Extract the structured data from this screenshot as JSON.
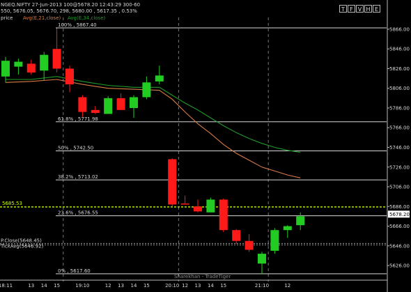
{
  "header": {
    "line1": "NGEQ.NIFTY 27-Jun-2013 100@5678.20 12:43:29 300-60",
    "line2": "550, 5676.05, 5676.70, 298, 5680.00 , 5617.35 , 0.53%",
    "line3_price": "price",
    "line3_avg21": "Avg(E,21,close)",
    "line3_avg34": "Avg(E,34,close)"
  },
  "window_buttons": [
    "T",
    "F",
    "V",
    "H",
    "E"
  ],
  "watermark": "Sharekhan - TradeTiger",
  "colors": {
    "background": "#000000",
    "up": "#22cc22",
    "down": "#ff1a1a",
    "ema21": "#d97b45",
    "ema34": "#1f9c2b",
    "fib": "#d8d8d8",
    "price_line": "#c8ff00",
    "text": "#d8d8d8"
  },
  "chart_data": {
    "type": "candlestick",
    "ylim": [
      5614,
      5878
    ],
    "y_ticks": [
      5866,
      5846,
      5826,
      5806,
      5786,
      5766,
      5746,
      5726,
      5706,
      5686,
      5666,
      5646,
      5626
    ],
    "x_ticks": [
      "18:11",
      "13",
      "14",
      "15",
      "19:10",
      "12",
      "13",
      "14",
      "15",
      "20:10",
      "12",
      "13",
      "14",
      "15",
      "21:10",
      "12"
    ],
    "day_separators_after_index": [
      4,
      13,
      20
    ],
    "candles": [
      {
        "open": 5818,
        "high": 5838,
        "low": 5812,
        "close": 5834
      },
      {
        "open": 5828,
        "high": 5836,
        "low": 5820,
        "close": 5833
      },
      {
        "open": 5831,
        "high": 5835,
        "low": 5820,
        "close": 5822
      },
      {
        "open": 5824,
        "high": 5843,
        "low": 5814,
        "close": 5840
      },
      {
        "open": 5846,
        "high": 5867,
        "low": 5822,
        "close": 5826
      },
      {
        "open": 5826,
        "high": 5829,
        "low": 5802,
        "close": 5810
      },
      {
        "open": 5797,
        "high": 5799,
        "low": 5777,
        "close": 5782
      },
      {
        "open": 5784,
        "high": 5788,
        "low": 5780,
        "close": 5781
      },
      {
        "open": 5780,
        "high": 5798,
        "low": 5780,
        "close": 5796
      },
      {
        "open": 5796,
        "high": 5801,
        "low": 5785,
        "close": 5784
      },
      {
        "open": 5786,
        "high": 5799,
        "low": 5776,
        "close": 5797
      },
      {
        "open": 5797,
        "high": 5818,
        "low": 5795,
        "close": 5812
      },
      {
        "open": 5813,
        "high": 5829,
        "low": 5810,
        "close": 5819
      },
      {
        "open": 5734,
        "high": 5735,
        "low": 5686,
        "close": 5688
      },
      {
        "open": 5689,
        "high": 5697,
        "low": 5688,
        "close": 5688
      },
      {
        "open": 5686,
        "high": 5693,
        "low": 5680,
        "close": 5681
      },
      {
        "open": 5680,
        "high": 5695,
        "low": 5680,
        "close": 5693
      },
      {
        "open": 5693,
        "high": 5694,
        "low": 5660,
        "close": 5662
      },
      {
        "open": 5662,
        "high": 5663,
        "low": 5648,
        "close": 5651
      },
      {
        "open": 5651,
        "high": 5658,
        "low": 5640,
        "close": 5642
      },
      {
        "open": 5628,
        "high": 5640,
        "low": 5617,
        "close": 5638
      },
      {
        "open": 5641,
        "high": 5664,
        "low": 5638,
        "close": 5662
      },
      {
        "open": 5662,
        "high": 5667,
        "low": 5654,
        "close": 5666
      },
      {
        "open": 5667,
        "high": 5680,
        "low": 5662,
        "close": 5676
      }
    ],
    "fib_levels": [
      {
        "label": "100% , 5867.40",
        "value": 5867.4
      },
      {
        "label": "61.8% , 5771.98",
        "value": 5771.98
      },
      {
        "label": "50% , 5742.50",
        "value": 5742.5
      },
      {
        "label": "38.2% , 5713.02",
        "value": 5713.02
      },
      {
        "label": "23.6% , 5676.55",
        "value": 5676.55
      },
      {
        "label": "0% , 5617.60",
        "value": 5617.6
      }
    ],
    "series": [
      {
        "name": "Avg(E,21,close)",
        "points": [
          [
            0,
            5812
          ],
          [
            2,
            5813
          ],
          [
            4,
            5815
          ],
          [
            6,
            5810
          ],
          [
            8,
            5806
          ],
          [
            10,
            5805
          ],
          [
            12,
            5804
          ],
          [
            13,
            5795
          ],
          [
            14,
            5782
          ],
          [
            15,
            5770
          ],
          [
            16,
            5760
          ],
          [
            17,
            5749
          ],
          [
            18,
            5740
          ],
          [
            19,
            5733
          ],
          [
            20,
            5726
          ],
          [
            21,
            5722
          ],
          [
            22,
            5718
          ],
          [
            23,
            5715
          ]
        ]
      },
      {
        "name": "Avg(E,34,close)",
        "points": [
          [
            0,
            5815
          ],
          [
            2,
            5815
          ],
          [
            4,
            5818
          ],
          [
            6,
            5813
          ],
          [
            8,
            5809
          ],
          [
            10,
            5807
          ],
          [
            12,
            5807
          ],
          [
            13,
            5799
          ],
          [
            14,
            5791
          ],
          [
            15,
            5784
          ],
          [
            16,
            5776
          ],
          [
            17,
            5768
          ],
          [
            18,
            5761
          ],
          [
            19,
            5755
          ],
          [
            20,
            5750
          ],
          [
            21,
            5746
          ],
          [
            22,
            5743
          ],
          [
            23,
            5741
          ]
        ]
      }
    ],
    "price_line": {
      "label": "5685.53",
      "value": 5685.53
    },
    "last_price_marker": "5678.20",
    "extra_labels": [
      {
        "label": "P.Close(5648.45)",
        "value": 5648.45
      },
      {
        "label": "TickAvg(5646.92)",
        "value": 5646.92
      }
    ]
  }
}
